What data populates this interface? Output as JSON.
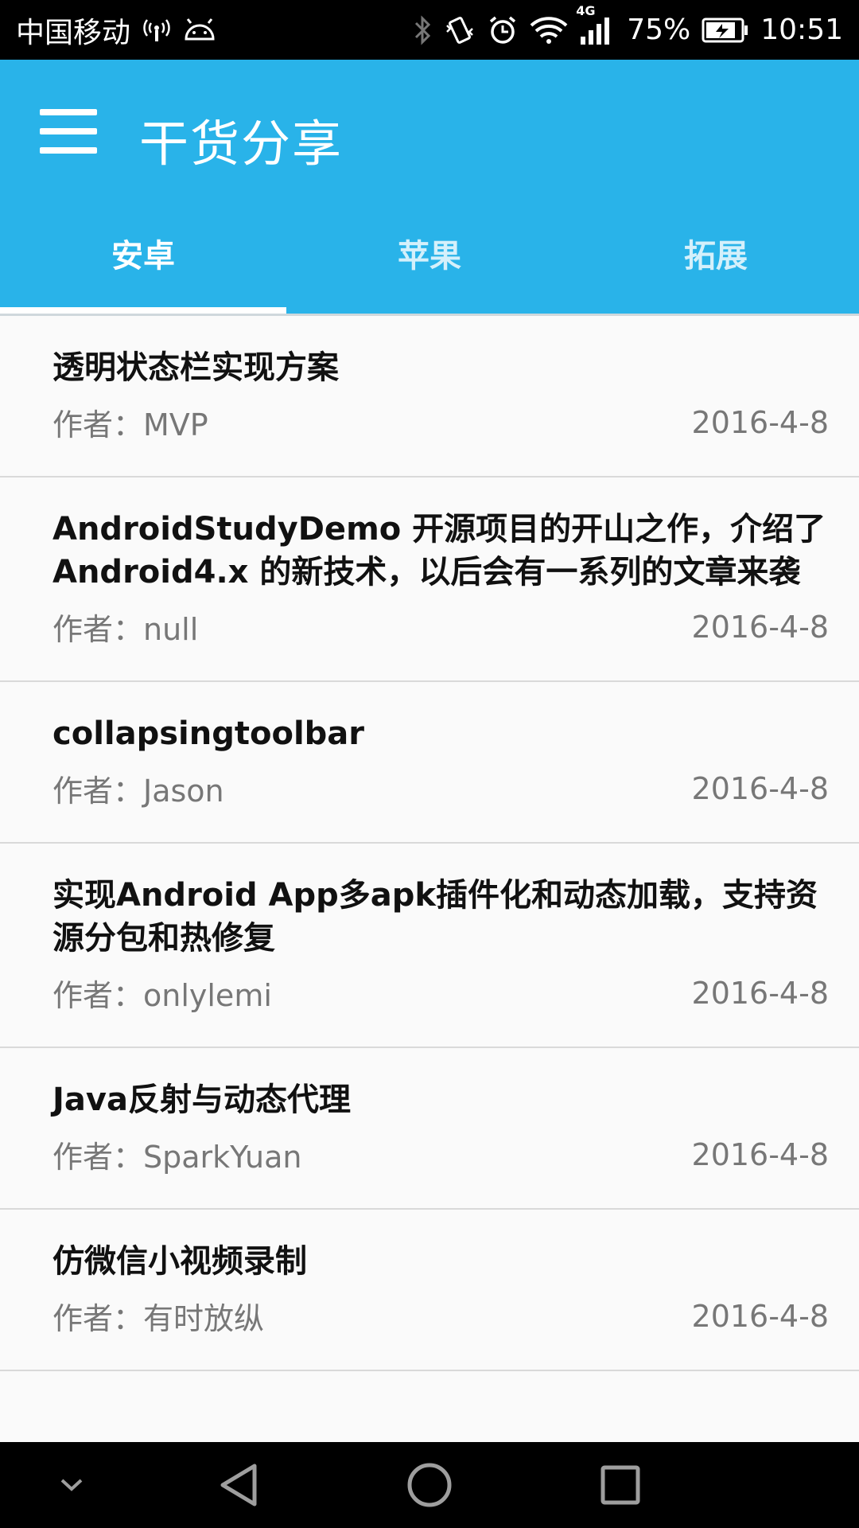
{
  "status_bar": {
    "carrier": "中国移动",
    "network": "4G",
    "battery": "75%",
    "time": "10:51",
    "icons": [
      "hotspot-icon",
      "android-icon",
      "bluetooth-icon",
      "vibrate-icon",
      "alarm-icon",
      "wifi-icon",
      "signal-icon",
      "battery-icon"
    ]
  },
  "app_bar": {
    "title": "干货分享",
    "menu_icon": "menu-icon",
    "accent": "#29b3e9"
  },
  "tabs": [
    {
      "label": "安卓",
      "active": true
    },
    {
      "label": "苹果",
      "active": false
    },
    {
      "label": "拓展",
      "active": false
    }
  ],
  "articles": [
    {
      "title": "透明状态栏实现方案",
      "author": "作者：MVP",
      "date": "2016-4-8"
    },
    {
      "title": "AndroidStudyDemo 开源项目的开山之作，介绍了 Android4.x 的新技术，以后会有一系列的文章来袭",
      "author": "作者：null",
      "date": "2016-4-8"
    },
    {
      "title": "collapsingtoolbar",
      "author": "作者：Jason",
      "date": "2016-4-8"
    },
    {
      "title": "实现Android App多apk插件化和动态加载，支持资源分包和热修复",
      "author": "作者：onlylemi",
      "date": "2016-4-8"
    },
    {
      "title": "Java反射与动态代理",
      "author": "作者：SparkYuan",
      "date": "2016-4-8"
    },
    {
      "title": "仿微信小视频录制",
      "author": "作者：有时放纵",
      "date": "2016-4-8"
    }
  ],
  "nav_bar": {
    "icons": [
      "hide-chevron-icon",
      "back-icon",
      "home-icon",
      "recents-icon"
    ]
  }
}
